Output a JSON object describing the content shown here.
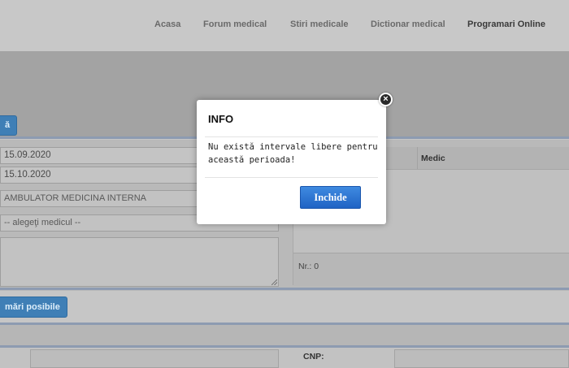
{
  "nav": {
    "items": [
      "Acasa",
      "Forum medical",
      "Stiri medicale",
      "Dictionar medical",
      "Programari Online"
    ]
  },
  "form": {
    "search_button_label": "ă",
    "date_from": "15.09.2020",
    "date_to": "15.10.2020",
    "specialty": "AMBULATOR MEDICINA INTERNA",
    "doctor_placeholder": "-- alegeţi medicul --",
    "possible_button_label": "mări posibile"
  },
  "table": {
    "col_medic": "Medic",
    "nr_label": "Nr.: 0"
  },
  "patient": {
    "cnp_label": "CNP:"
  },
  "modal": {
    "title": "INFO",
    "message": "Nu există intervale libere pentru această perioada!",
    "close_button": "Inchide",
    "close_glyph": "×"
  },
  "colors": {
    "accent": "#1f63c4",
    "rule": "#8d9bb1"
  }
}
